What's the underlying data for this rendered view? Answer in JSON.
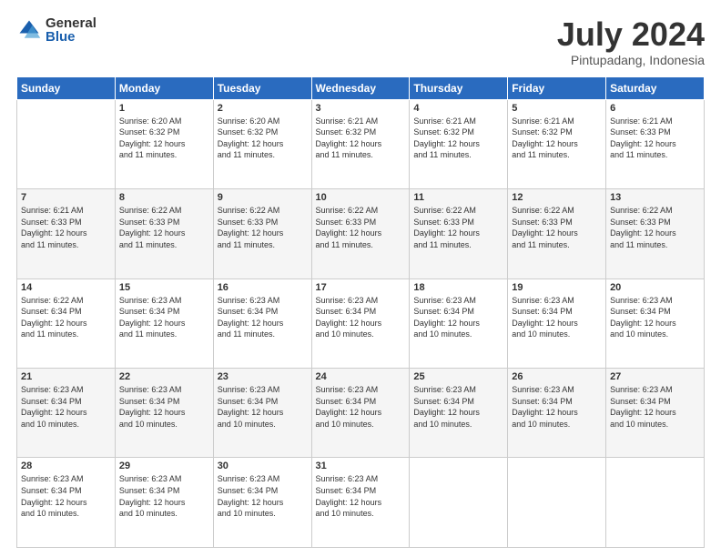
{
  "logo": {
    "general": "General",
    "blue": "Blue"
  },
  "header": {
    "month_year": "July 2024",
    "location": "Pintupadang, Indonesia"
  },
  "days_of_week": [
    "Sunday",
    "Monday",
    "Tuesday",
    "Wednesday",
    "Thursday",
    "Friday",
    "Saturday"
  ],
  "weeks": [
    [
      {
        "day": "",
        "info": ""
      },
      {
        "day": "1",
        "info": "Sunrise: 6:20 AM\nSunset: 6:32 PM\nDaylight: 12 hours\nand 11 minutes."
      },
      {
        "day": "2",
        "info": "Sunrise: 6:20 AM\nSunset: 6:32 PM\nDaylight: 12 hours\nand 11 minutes."
      },
      {
        "day": "3",
        "info": "Sunrise: 6:21 AM\nSunset: 6:32 PM\nDaylight: 12 hours\nand 11 minutes."
      },
      {
        "day": "4",
        "info": "Sunrise: 6:21 AM\nSunset: 6:32 PM\nDaylight: 12 hours\nand 11 minutes."
      },
      {
        "day": "5",
        "info": "Sunrise: 6:21 AM\nSunset: 6:32 PM\nDaylight: 12 hours\nand 11 minutes."
      },
      {
        "day": "6",
        "info": "Sunrise: 6:21 AM\nSunset: 6:33 PM\nDaylight: 12 hours\nand 11 minutes."
      }
    ],
    [
      {
        "day": "7",
        "info": "Sunrise: 6:21 AM\nSunset: 6:33 PM\nDaylight: 12 hours\nand 11 minutes."
      },
      {
        "day": "8",
        "info": "Sunrise: 6:22 AM\nSunset: 6:33 PM\nDaylight: 12 hours\nand 11 minutes."
      },
      {
        "day": "9",
        "info": "Sunrise: 6:22 AM\nSunset: 6:33 PM\nDaylight: 12 hours\nand 11 minutes."
      },
      {
        "day": "10",
        "info": "Sunrise: 6:22 AM\nSunset: 6:33 PM\nDaylight: 12 hours\nand 11 minutes."
      },
      {
        "day": "11",
        "info": "Sunrise: 6:22 AM\nSunset: 6:33 PM\nDaylight: 12 hours\nand 11 minutes."
      },
      {
        "day": "12",
        "info": "Sunrise: 6:22 AM\nSunset: 6:33 PM\nDaylight: 12 hours\nand 11 minutes."
      },
      {
        "day": "13",
        "info": "Sunrise: 6:22 AM\nSunset: 6:33 PM\nDaylight: 12 hours\nand 11 minutes."
      }
    ],
    [
      {
        "day": "14",
        "info": "Sunrise: 6:22 AM\nSunset: 6:34 PM\nDaylight: 12 hours\nand 11 minutes."
      },
      {
        "day": "15",
        "info": "Sunrise: 6:23 AM\nSunset: 6:34 PM\nDaylight: 12 hours\nand 11 minutes."
      },
      {
        "day": "16",
        "info": "Sunrise: 6:23 AM\nSunset: 6:34 PM\nDaylight: 12 hours\nand 11 minutes."
      },
      {
        "day": "17",
        "info": "Sunrise: 6:23 AM\nSunset: 6:34 PM\nDaylight: 12 hours\nand 10 minutes."
      },
      {
        "day": "18",
        "info": "Sunrise: 6:23 AM\nSunset: 6:34 PM\nDaylight: 12 hours\nand 10 minutes."
      },
      {
        "day": "19",
        "info": "Sunrise: 6:23 AM\nSunset: 6:34 PM\nDaylight: 12 hours\nand 10 minutes."
      },
      {
        "day": "20",
        "info": "Sunrise: 6:23 AM\nSunset: 6:34 PM\nDaylight: 12 hours\nand 10 minutes."
      }
    ],
    [
      {
        "day": "21",
        "info": "Sunrise: 6:23 AM\nSunset: 6:34 PM\nDaylight: 12 hours\nand 10 minutes."
      },
      {
        "day": "22",
        "info": "Sunrise: 6:23 AM\nSunset: 6:34 PM\nDaylight: 12 hours\nand 10 minutes."
      },
      {
        "day": "23",
        "info": "Sunrise: 6:23 AM\nSunset: 6:34 PM\nDaylight: 12 hours\nand 10 minutes."
      },
      {
        "day": "24",
        "info": "Sunrise: 6:23 AM\nSunset: 6:34 PM\nDaylight: 12 hours\nand 10 minutes."
      },
      {
        "day": "25",
        "info": "Sunrise: 6:23 AM\nSunset: 6:34 PM\nDaylight: 12 hours\nand 10 minutes."
      },
      {
        "day": "26",
        "info": "Sunrise: 6:23 AM\nSunset: 6:34 PM\nDaylight: 12 hours\nand 10 minutes."
      },
      {
        "day": "27",
        "info": "Sunrise: 6:23 AM\nSunset: 6:34 PM\nDaylight: 12 hours\nand 10 minutes."
      }
    ],
    [
      {
        "day": "28",
        "info": "Sunrise: 6:23 AM\nSunset: 6:34 PM\nDaylight: 12 hours\nand 10 minutes."
      },
      {
        "day": "29",
        "info": "Sunrise: 6:23 AM\nSunset: 6:34 PM\nDaylight: 12 hours\nand 10 minutes."
      },
      {
        "day": "30",
        "info": "Sunrise: 6:23 AM\nSunset: 6:34 PM\nDaylight: 12 hours\nand 10 minutes."
      },
      {
        "day": "31",
        "info": "Sunrise: 6:23 AM\nSunset: 6:34 PM\nDaylight: 12 hours\nand 10 minutes."
      },
      {
        "day": "",
        "info": ""
      },
      {
        "day": "",
        "info": ""
      },
      {
        "day": "",
        "info": ""
      }
    ]
  ]
}
